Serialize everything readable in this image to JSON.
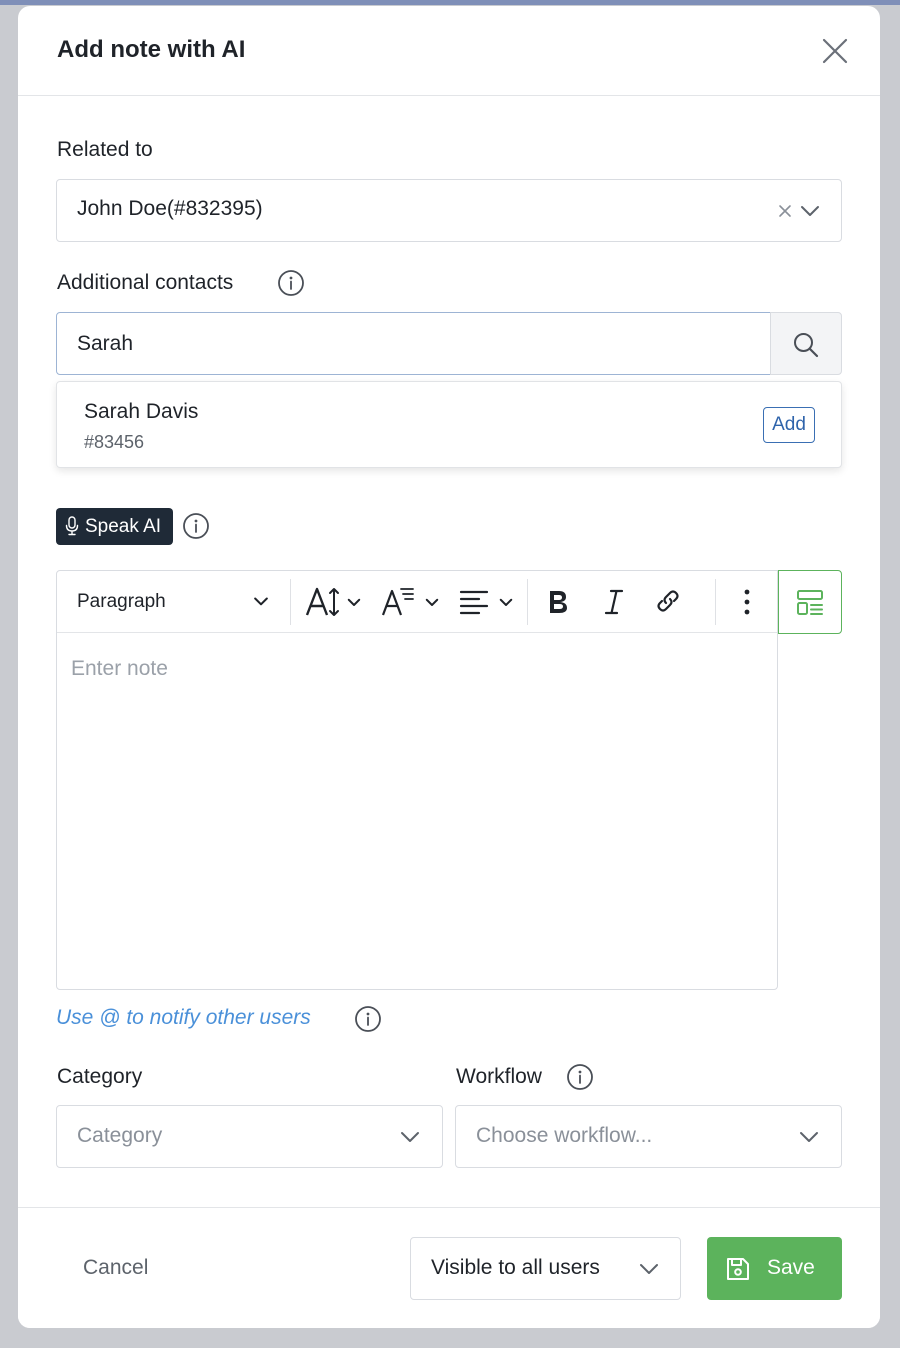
{
  "modal": {
    "title": "Add note with AI"
  },
  "related": {
    "label": "Related to",
    "value": "John Doe(#832395)"
  },
  "contacts": {
    "label": "Additional contacts",
    "search_value": "Sarah",
    "suggestion": {
      "name": "Sarah Davis",
      "id": "#83456",
      "add_label": "Add"
    }
  },
  "speak": {
    "label": "Speak AI"
  },
  "editor": {
    "block_format": "Paragraph",
    "placeholder": "Enter note"
  },
  "hint": {
    "text": "Use @ to notify other users"
  },
  "category": {
    "label": "Category",
    "placeholder": "Category"
  },
  "workflow": {
    "label": "Workflow",
    "placeholder": "Choose workflow..."
  },
  "footer": {
    "cancel_label": "Cancel",
    "visibility": "Visible to all users",
    "save_label": "Save"
  },
  "colors": {
    "primary_dark": "#1f2a37",
    "success": "#5cb35c",
    "link": "#4a90d9",
    "border": "#d9dce1"
  },
  "icons": [
    "close-icon",
    "info-icon",
    "chevron-down-icon",
    "clear-icon",
    "search-icon",
    "microphone-icon",
    "font-size-icon",
    "text-style-icon",
    "align-icon",
    "bold-icon",
    "italic-icon",
    "link-icon",
    "more-vertical-icon",
    "template-icon",
    "save-icon"
  ]
}
